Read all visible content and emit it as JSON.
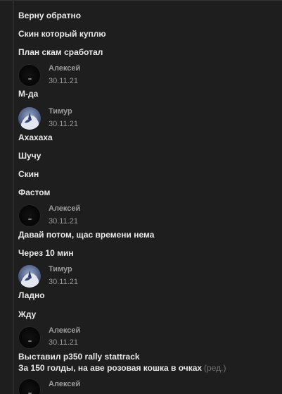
{
  "messages": {
    "m1": "Верну обратно",
    "m2": "Скин который куплю",
    "m3": "План скам сработал",
    "m4": "М-да",
    "m5": "Ахахаха",
    "m6": "Шучу",
    "m7": "Скин",
    "m8": "Фастом",
    "m9": "Давай потом, щас времени нема",
    "m10": "Через 10 мин",
    "m11": "Ладно",
    "m12": "Жду",
    "m13": "Выставил p350 rally stattrack",
    "m14": "За 150 голды, на аве розовая кошка в очках",
    "edited_label": "(ред.)"
  },
  "headers": {
    "h1": {
      "name": "Алексей",
      "date": "30.11.21"
    },
    "h2": {
      "name": "Тимур",
      "date": "30.11.21"
    },
    "h3": {
      "name": "Алексей",
      "date": "30.11.21"
    },
    "h4": {
      "name": "Тимур",
      "date": "30.11.21"
    },
    "h5": {
      "name": "Алексей",
      "date": "30.11.21"
    },
    "h6": {
      "name": "Алексей"
    }
  },
  "colors": {
    "background": "#1e1e1e",
    "message_text": "#e8e8e8",
    "author_name": "#9c9c9c",
    "date_text": "#9a9a9a",
    "edited_text": "#6f6f6f"
  }
}
